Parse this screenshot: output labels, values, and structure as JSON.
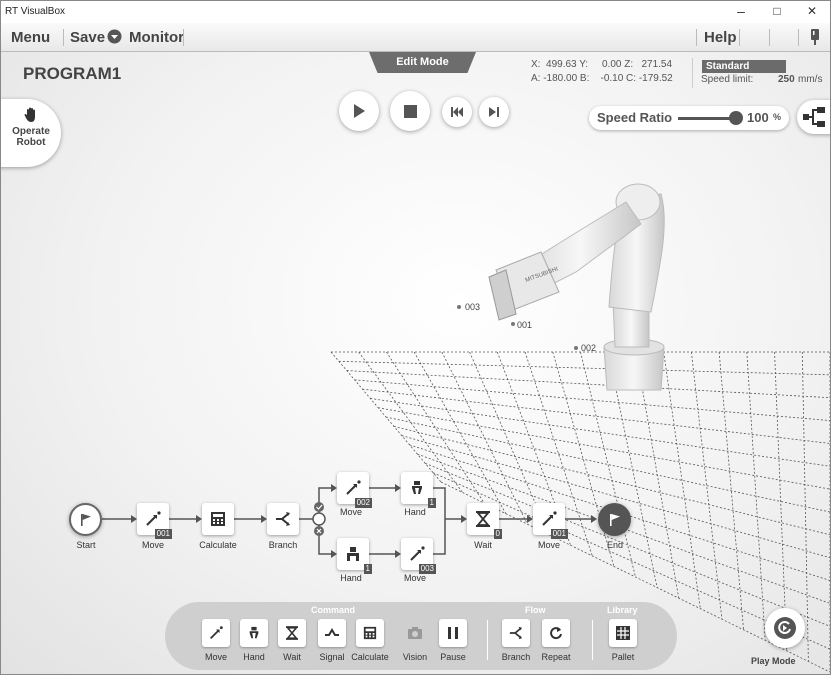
{
  "window": {
    "title": "RT VisualBox",
    "min": "–",
    "max": "□",
    "close": "✕"
  },
  "menu": {
    "menu": "Menu",
    "save": "Save",
    "monitor": "Monitor",
    "help": "Help"
  },
  "program": {
    "name": "PROGRAM1",
    "mode_tab": "Edit Mode"
  },
  "coords": {
    "line1": "X:  499.63 Y:     0.00 Z:   271.54",
    "line2": "A: -180.00 B:    -0.10 C: -179.52"
  },
  "speed": {
    "profile": "Standard",
    "limit_label": "Speed limit:",
    "limit_value": "250",
    "limit_unit": "mm/s",
    "ratio_label": "Speed Ratio",
    "ratio_value": "100",
    "ratio_unit": "%",
    "ratio_level": 1.0
  },
  "operate": {
    "label1": "Operate",
    "label2": "Robot"
  },
  "points": [
    "003",
    "001",
    "002"
  ],
  "flow": {
    "nodes": [
      {
        "label": "Start",
        "badge": ""
      },
      {
        "label": "Move",
        "badge": "001"
      },
      {
        "label": "Calculate",
        "badge": ""
      },
      {
        "label": "Branch",
        "badge": ""
      },
      {
        "label": "Move",
        "badge": "002"
      },
      {
        "label": "Hand",
        "badge": "1"
      },
      {
        "label": "Hand",
        "badge": "1"
      },
      {
        "label": "Move",
        "badge": "003"
      },
      {
        "label": "Wait",
        "badge": "0"
      },
      {
        "label": "Move",
        "badge": "001"
      },
      {
        "label": "End",
        "badge": ""
      }
    ]
  },
  "palette": {
    "command_title": "Command",
    "flow_title": "Flow",
    "library_title": "Library",
    "buttons": [
      "Move",
      "Hand",
      "Wait",
      "Signal",
      "Calculate",
      "Vision",
      "Pause",
      "Branch",
      "Repeat",
      "Pallet"
    ]
  },
  "play_mode": "Play Mode",
  "colors": {
    "accent": "#6d6d6d",
    "panel": "#cfcfcf"
  }
}
